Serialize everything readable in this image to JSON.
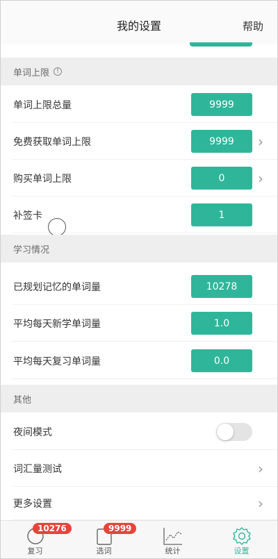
{
  "header": {
    "title": "我的设置",
    "help": "帮助"
  },
  "sections": {
    "word_limit": {
      "title": "单词上限",
      "rows": {
        "total": {
          "label": "单词上限总量",
          "value": "9999"
        },
        "free": {
          "label": "免费获取单词上限",
          "value": "9999"
        },
        "buy": {
          "label": "购买单词上限",
          "value": "0"
        },
        "makeup": {
          "label": "补签卡",
          "value": "1"
        }
      }
    },
    "study": {
      "title": "学习情况",
      "rows": {
        "planned": {
          "label": "已规划记忆的单词量",
          "value": "10278"
        },
        "new_avg": {
          "label": "平均每天新学单词量",
          "value": "1.0"
        },
        "review_avg": {
          "label": "平均每天复习单词量",
          "value": "0.0"
        }
      }
    },
    "other": {
      "title": "其他",
      "rows": {
        "night": {
          "label": "夜间模式",
          "enabled": false
        },
        "vocab_test": {
          "label": "词汇量测试"
        },
        "more": {
          "label": "更多设置"
        }
      }
    }
  },
  "tabbar": {
    "review": {
      "label": "复习",
      "badge": "10276"
    },
    "select": {
      "label": "选词",
      "badge": "9999"
    },
    "stats": {
      "label": "统计"
    },
    "settings": {
      "label": "设置",
      "active": true
    }
  },
  "colors": {
    "accent": "#2fb69a",
    "badge": "#e8443a"
  }
}
